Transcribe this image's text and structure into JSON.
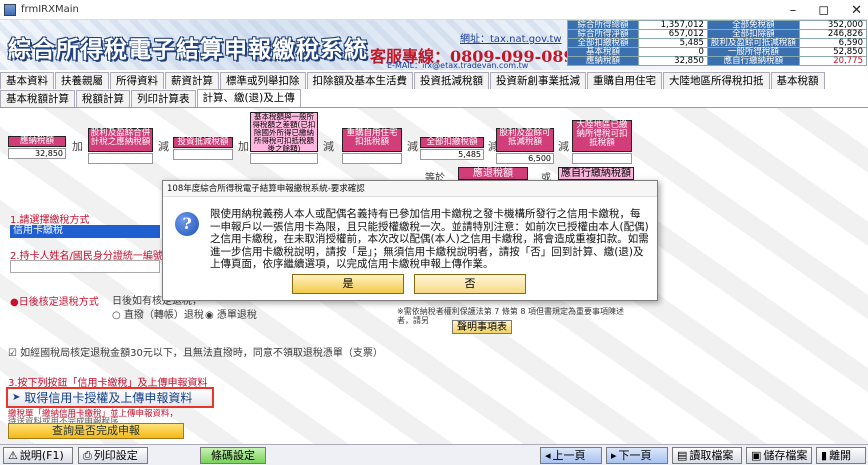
{
  "window": {
    "title": "frmIRXMain",
    "minimize": "–",
    "restore": "◻",
    "close": "✕"
  },
  "header": {
    "app_title": "綜合所得稅電子結算申報繳稅系統",
    "url_label": "網址：tax.nat.gov.tw",
    "hotline": "客服專線：0809-099-089",
    "email": "E-MAIL：irx@etax.tradevan.com.tw"
  },
  "summary": {
    "rows": [
      {
        "label1": "綜合所得總額",
        "value1": "1,357,012",
        "label2": "全部免稅額",
        "value2": "352,000"
      },
      {
        "label1": "綜合所得淨額",
        "value1": "657,012",
        "label2": "全部扣除額",
        "value2": "246,826"
      },
      {
        "label1": "全部扣繳稅額",
        "value1": "5,485",
        "label2": "股利及盈餘可抵減稅額",
        "value2": "6,590"
      },
      {
        "label1": "基本稅額",
        "value1": "0",
        "label2": "一般所得稅額",
        "value2": "52,850"
      },
      {
        "label1": "應納稅額",
        "value1": "32,850",
        "label2": "應自行繳納稅額",
        "value2": "20,775"
      }
    ]
  },
  "tabs_row1": [
    "基本資料",
    "扶養親屬",
    "所得資料",
    "薪資計算",
    "標準或列舉扣除",
    "扣除額及基本生活費",
    "投資抵減稅額",
    "投資新創事業抵減",
    "重購自用住宅",
    "大陸地區所得稅扣抵",
    "基本稅額"
  ],
  "tabs_row2": [
    "基本稅額計算",
    "稅額計算",
    "列印計算表",
    "計算、繳(退)及上傳"
  ],
  "formula": {
    "boxes": [
      {
        "label": "應納稅額",
        "value": "32,850"
      },
      {
        "label": "股利及盈餘合併計稅之應納稅額",
        "value": ""
      },
      {
        "label": "投資抵減稅額",
        "value": ""
      },
      {
        "label": "基本稅額與一般所得稅額之差額(已扣除國外所得已繳納所得稅可扣抵稅額後之餘額)",
        "value": ""
      },
      {
        "label": "重購自用住宅扣抵稅額",
        "value": ""
      },
      {
        "label": "全部扣繳稅額",
        "value": "5,485"
      },
      {
        "label": "股利及盈餘可抵減稅額",
        "value": "6,500"
      },
      {
        "label": "大陸地區已繳納所得稅可扣抵稅額",
        "value": ""
      }
    ],
    "ops": [
      "加",
      "減",
      "加",
      "減",
      "減",
      "減",
      "減"
    ],
    "equals": "等於",
    "refund_label": "應退稅額",
    "or": "或",
    "payable_label": "應自行繳納稅額"
  },
  "section": {
    "payment_method_label": "1.請選擇繳稅方式",
    "payment_method_value": "信用卡繳稅",
    "cardholder_label": "2.持卡人姓名/國民身分證統一編號",
    "refund_method_label": "●日後核定退稅方式",
    "refund_option_text": "日後如有核定退稅，",
    "direct_refund": "直撥（轉帳）退稅",
    "check_refund": "憑單退稅",
    "note_text": "※需依納稅者權利保護法第 7 條第 8 項但書規定為重要事項陳述者，請另",
    "note_button": "聲明事項表",
    "checkbox_text": "如經國稅局核定退稅金額30元以下，且無法直撥時，同意不領取退稅憑單（支票）",
    "step3_label": "3.按下列按鈕「信用卡繳稅」及上傳申報資料",
    "upload_button": "取得信用卡授權及上傳申報資料",
    "warning_text": "繳稅單「繳納信用卡繳稅」並上傳申報資料，",
    "warning_text2": "待送資料或用不完成申報程序",
    "check_button": "查詢是否完成申報"
  },
  "dialog": {
    "title": "108年度綜合所得稅電子結算申報繳稅系統-要求確認",
    "message": "限使用納稅義務人本人或配偶名義持有已參加信用卡繳稅之發卡機構所發行之信用卡繳稅，每一申報戶以一張信用卡為限，且只能授權繳稅一次。並請特別注意：如前次已授權由本人(配偶)之信用卡繳稅，在未取消授權前，本次改以配偶(本人)之信用卡繳稅，將會造成重複扣款。如需進一步信用卡繳稅說明，請按「是」；無須信用卡繳稅說明者，請按「否」回到計算、繳(退)及上傳頁面，依序繼續選項，以完成信用卡繳稅申報上傳作業。",
    "yes": "是",
    "no": "否"
  },
  "bottom": {
    "help": "說明(F1)",
    "print_settings": "列印設定",
    "barcode_settings": "條碼設定",
    "prev": "上一頁",
    "next": "下一頁",
    "read_file": "讀取檔案",
    "save_file": "儲存檔案",
    "exit": "離開"
  }
}
